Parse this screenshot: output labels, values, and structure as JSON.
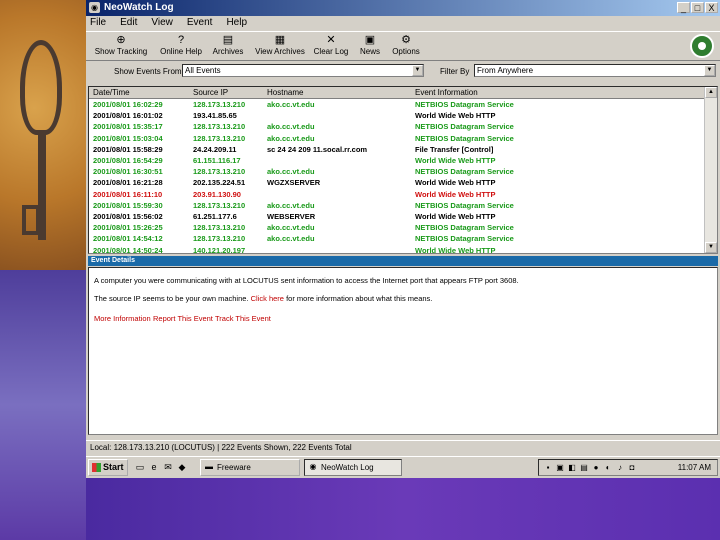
{
  "window": {
    "title": "NeoWatch Log",
    "controls": [
      "_",
      "□",
      "X"
    ]
  },
  "menu": [
    "File",
    "Edit",
    "View",
    "Event",
    "Help"
  ],
  "toolbar": [
    {
      "label": "Show Tracking",
      "icon": "target-icon"
    },
    {
      "label": "Online Help",
      "icon": "help-icon"
    },
    {
      "label": "Archives",
      "icon": "archive-icon"
    },
    {
      "label": "View Archives",
      "icon": "view-archive-icon"
    },
    {
      "label": "Clear Log",
      "icon": "clear-icon"
    },
    {
      "label": "News",
      "icon": "news-icon"
    },
    {
      "label": "Options",
      "icon": "options-icon"
    }
  ],
  "filters": {
    "show_label": "Show Events From",
    "show_value": "All Events",
    "filter_label": "Filter By",
    "filter_value": "From Anywhere"
  },
  "table": {
    "columns": [
      "Date/Time",
      "Source IP",
      "Hostname",
      "Event Information"
    ],
    "rows": [
      {
        "date": "2001/08/01 16:02:29",
        "ip": "128.173.13.210",
        "host": "ako.cc.vt.edu",
        "info": "NETBIOS Datagram Service",
        "color": "#1a9a1a"
      },
      {
        "date": "2001/08/01 16:01:02",
        "ip": "193.41.85.65",
        "host": "",
        "info": "World Wide Web HTTP",
        "color": "#000000"
      },
      {
        "date": "2001/08/01 15:35:17",
        "ip": "128.173.13.210",
        "host": "ako.cc.vt.edu",
        "info": "NETBIOS Datagram Service",
        "color": "#1a9a1a"
      },
      {
        "date": "2001/08/01 15:03:04",
        "ip": "128.173.13.210",
        "host": "ako.cc.vt.edu",
        "info": "NETBIOS Datagram Service",
        "color": "#1a9a1a"
      },
      {
        "date": "2001/08/01 15:58:29",
        "ip": "24.24.209.11",
        "host": "sc 24 24 209 11.socal.rr.com",
        "info": "File Transfer [Control]",
        "color": "#000000"
      },
      {
        "date": "2001/08/01 16:54:29",
        "ip": "61.151.116.17",
        "host": "",
        "info": "World Wide Web HTTP",
        "color": "#1a9a1a"
      },
      {
        "date": "2001/08/01 16:30:51",
        "ip": "128.173.13.210",
        "host": "ako.cc.vt.edu",
        "info": "NETBIOS Datagram Service",
        "color": "#1a9a1a"
      },
      {
        "date": "2001/08/01 16:21:28",
        "ip": "202.135.224.51",
        "host": "WGZXSERVER",
        "info": "World Wide Web HTTP",
        "color": "#000000"
      },
      {
        "date": "2001/08/01 16:11:10",
        "ip": "203.91.130.90",
        "host": "",
        "info": "World Wide Web HTTP",
        "color": "#d01010"
      },
      {
        "date": "2001/08/01 15:59:30",
        "ip": "128.173.13.210",
        "host": "ako.cc.vt.edu",
        "info": "NETBIOS Datagram Service",
        "color": "#1a9a1a"
      },
      {
        "date": "2001/08/01 15:56:02",
        "ip": "61.251.177.6",
        "host": "WEBSERVER",
        "info": "World Wide Web HTTP",
        "color": "#000000"
      },
      {
        "date": "2001/08/01 15:26:25",
        "ip": "128.173.13.210",
        "host": "ako.cc.vt.edu",
        "info": "NETBIOS Datagram Service",
        "color": "#1a9a1a"
      },
      {
        "date": "2001/08/01 14:54:12",
        "ip": "128.173.13.210",
        "host": "ako.cc.vt.edu",
        "info": "NETBIOS Datagram Service",
        "color": "#1a9a1a"
      },
      {
        "date": "2001/08/01 14:50:24",
        "ip": "140.121.20.197",
        "host": "",
        "info": "World Wide Web HTTP",
        "color": "#1a9a1a"
      }
    ]
  },
  "details": {
    "header": "Event Details",
    "line1": "A computer you were communicating with at LOCUTUS sent information to access the Internet port that appears FTP port 3608.",
    "line2_pre": "The source IP seems to be your own machine.",
    "line2_link": "Click here",
    "line2_post": "for more information about what this means.",
    "links": [
      "More Information",
      "Report This Event",
      "Track This Event"
    ]
  },
  "status": "Local: 128.173.13.210 (LOCUTUS) | 222 Events Shown, 222 Events Total",
  "taskbar": {
    "start": "Start",
    "buttons": [
      {
        "label": "Freeware",
        "active": false
      },
      {
        "label": "NeoWatch Log",
        "active": true
      }
    ],
    "clock": "11:07 AM"
  }
}
